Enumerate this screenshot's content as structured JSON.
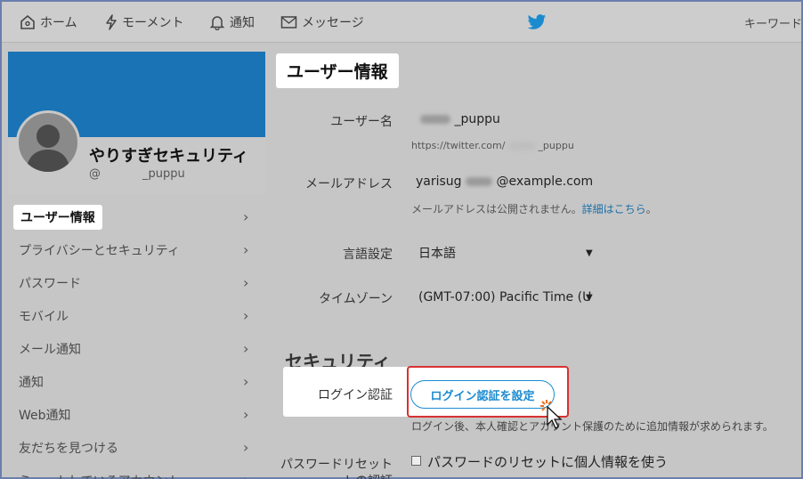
{
  "nav": {
    "home": "ホーム",
    "moments": "モーメント",
    "notifications": "通知",
    "messages": "メッセージ",
    "search_placeholder": "キーワード検"
  },
  "profile": {
    "display_name": "やりすぎセキュリティ",
    "handle_at": "@",
    "handle_suffix": "_puppu"
  },
  "sidebar": {
    "items": [
      {
        "label": "ユーザー情報",
        "active": true
      },
      {
        "label": "プライバシーとセキュリティ"
      },
      {
        "label": "パスワード"
      },
      {
        "label": "モバイル"
      },
      {
        "label": "メール通知"
      },
      {
        "label": "通知"
      },
      {
        "label": "Web通知"
      },
      {
        "label": "友だちを見つける"
      },
      {
        "label": "ミュートしているアカウント"
      }
    ],
    "chevron": "›"
  },
  "main": {
    "title": "ユーザー情報",
    "username": {
      "label": "ユーザー名",
      "value_suffix": "_puppu",
      "url_prefix": "https://twitter.com/",
      "url_suffix": "_puppu"
    },
    "email": {
      "label": "メールアドレス",
      "value_prefix": "yarisug",
      "value_suffix": "@example.com",
      "note": "メールアドレスは公開されません。",
      "note_link": "詳細はこちら",
      "note_end": "。"
    },
    "language": {
      "label": "言語設定",
      "value": "日本語"
    },
    "timezone": {
      "label": "タイムゾーン",
      "value": "(GMT-07:00) Pacific Time (U"
    },
    "security": {
      "title": "セキュリティ",
      "login_verification": {
        "label": "ログイン認証",
        "button": "ログイン認証を設定",
        "note": "ログイン後、本人確認とアカウント保護のために追加情報が求められます。"
      },
      "password_reset": {
        "label": "パスワードリセット",
        "label_line2": "トの認証",
        "checkbox_label": "パスワードのリセットに個人情報を使う"
      }
    }
  },
  "colors": {
    "banner": "#1a73b4",
    "accent": "#1b8bd0",
    "highlight_border": "#d93131"
  }
}
